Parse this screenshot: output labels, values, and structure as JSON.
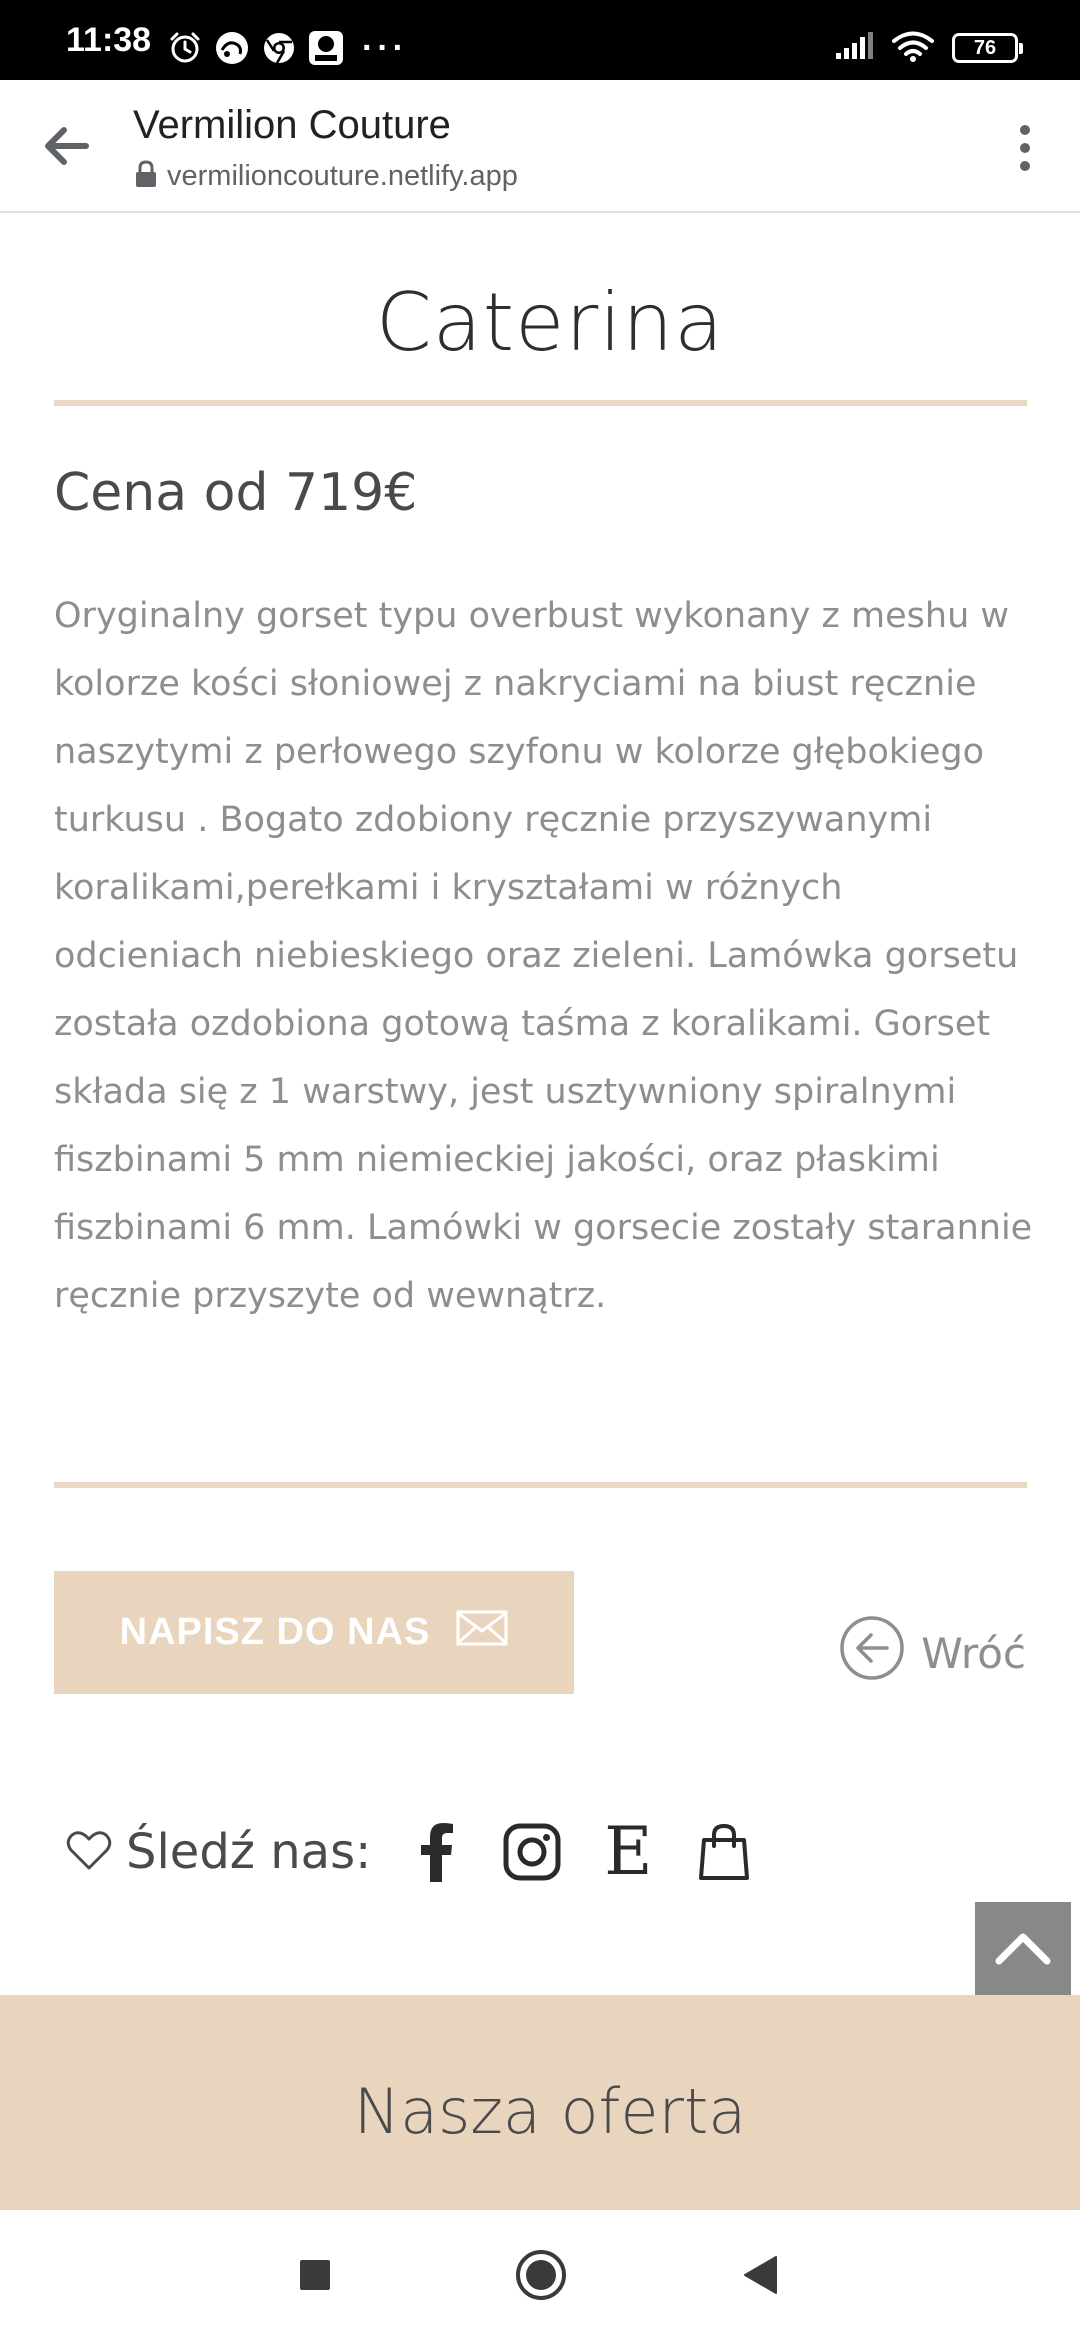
{
  "status_bar": {
    "time": "11:38",
    "more_indicator": "···",
    "battery_level": "76",
    "icons": [
      "alarm-icon",
      "notification-app-icon",
      "chrome-icon",
      "lidl-plus-icon",
      "signal-icon",
      "wifi-icon",
      "battery-icon"
    ]
  },
  "browser": {
    "site_title": "Vermilion Couture",
    "url": "vermilioncouture.netlify.app",
    "icons": [
      "back-arrow-icon",
      "lock-icon",
      "more-vert-icon"
    ]
  },
  "product": {
    "title": "Caterina",
    "price": "Cena od 719€",
    "description": "Oryginalny gorset typu overbust wykonany z meshu w kolorze kości słoniowej z nakryciami na biust ręcznie naszytymi z perłowego szyfonu w kolorze głębokiego turkusu . Bogato zdobiony ręcznie przyszywanymi koralikami,perełkami i kryształami w różnych odcieniach niebieskiego oraz zieleni. Lamówka gorsetu została ozdobiona gotową taśma z koralikami. Gorset składa się z 1 warstwy, jest usztywniony spiralnymi fiszbinami 5 mm niemieckiej jakości, oraz płaskimi fiszbinami 6 mm. Lamówki w gorsecie zostały starannie ręcznie przyszyte od wewnątrz."
  },
  "actions": {
    "contact_label": "NAPISZ DO NAS",
    "back_label": "Wróć"
  },
  "social": {
    "follow_label": "Śledź nas:",
    "etsy_letter": "E",
    "icons": [
      "heart-icon",
      "facebook-icon",
      "instagram-icon",
      "etsy-icon",
      "shopping-bag-icon"
    ]
  },
  "offer": {
    "title": "Nasza oferta"
  },
  "navigation": {
    "icons": [
      "recents-icon",
      "home-icon",
      "back-icon"
    ]
  },
  "colors": {
    "accent_beige": "#e9d5bd",
    "rule_beige": "#e9d8c2",
    "body_text_gray": "#8e8e8e",
    "scroll_top_gray": "#888888"
  }
}
